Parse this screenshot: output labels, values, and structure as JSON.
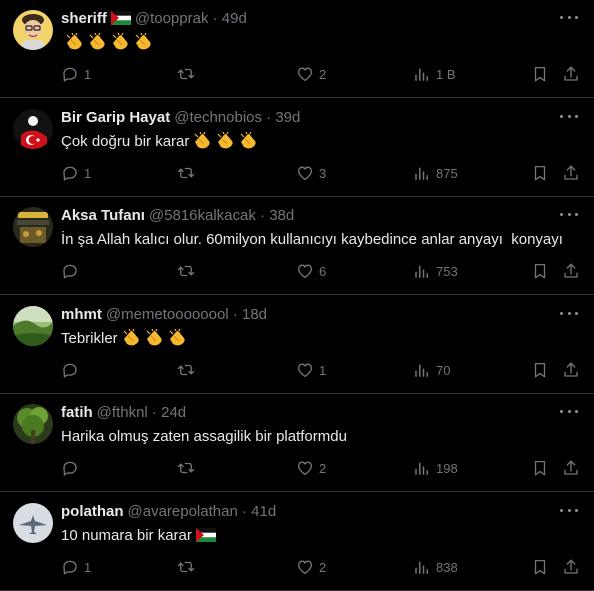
{
  "replies": [
    {
      "name": "sheriff",
      "handle": "@toopprak",
      "time": "49d",
      "text": "",
      "emoji_count": 4,
      "flag": true,
      "text_flag": false,
      "avatar": "bitmoji-avatar",
      "counts": {
        "reply": "1",
        "retweet": "",
        "like": "2",
        "views": "1 B"
      }
    },
    {
      "name": "Bir Garip Hayat",
      "handle": "@technobios",
      "time": "39d",
      "text": "Çok doğru bir karar",
      "emoji_count": 3,
      "flag": false,
      "text_flag": false,
      "avatar": "turkish-flag-avatar",
      "counts": {
        "reply": "1",
        "retweet": "",
        "like": "3",
        "views": "875"
      }
    },
    {
      "name": "Aksa Tufanı",
      "handle": "@5816kalkacak",
      "time": "38d",
      "text": "İn şa Allah kalıcı olur. 60milyon kullanıcıyı kaybedince anlar anyayı  konyayı",
      "emoji_count": 0,
      "flag": false,
      "text_flag": false,
      "avatar": "poster-avatar",
      "counts": {
        "reply": "",
        "retweet": "",
        "like": "6",
        "views": "753"
      }
    },
    {
      "name": "mhmt",
      "handle": "@memetoooooool",
      "time": "18d",
      "text": "Tebrikler",
      "emoji_count": 3,
      "flag": false,
      "text_flag": false,
      "avatar": "landscape-avatar",
      "counts": {
        "reply": "",
        "retweet": "",
        "like": "1",
        "views": "70"
      }
    },
    {
      "name": "fatih",
      "handle": "@fthknl",
      "time": "24d",
      "text": "Harika olmuş zaten assagilik bir platformdu",
      "emoji_count": 0,
      "flag": false,
      "text_flag": false,
      "avatar": "tree-avatar",
      "counts": {
        "reply": "",
        "retweet": "",
        "like": "2",
        "views": "198"
      }
    },
    {
      "name": "polathan",
      "handle": "@avarepolathan",
      "time": "41d",
      "text": "10 numara bir karar",
      "emoji_count": 0,
      "flag": false,
      "text_flag": true,
      "avatar": "jet-avatar",
      "counts": {
        "reply": "1",
        "retweet": "",
        "like": "2",
        "views": "838"
      }
    }
  ],
  "separator": "·",
  "colors": {
    "background": "#000000",
    "text": "#e7e9ea",
    "muted": "#71767b",
    "divider": "#2f3336"
  },
  "icons": [
    "reply-icon",
    "retweet-icon",
    "like-icon",
    "views-icon",
    "bookmark-icon",
    "share-icon",
    "more-icon"
  ]
}
